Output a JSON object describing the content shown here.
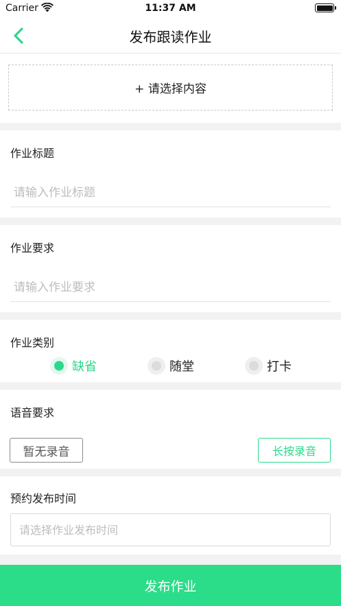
{
  "status_bar": {
    "carrier": "Carrier",
    "time": "11:37 AM"
  },
  "nav": {
    "title": "发布跟读作业",
    "back_icon": "chevron-left-icon"
  },
  "select_content": {
    "label": "+ 请选择内容"
  },
  "title_section": {
    "label": "作业标题",
    "placeholder": "请输入作业标题",
    "value": ""
  },
  "requirement_section": {
    "label": "作业要求",
    "placeholder": "请输入作业要求",
    "value": ""
  },
  "type_section": {
    "label": "作业类别",
    "options": [
      {
        "label": "缺省",
        "selected": true
      },
      {
        "label": "随堂",
        "selected": false
      },
      {
        "label": "打卡",
        "selected": false
      }
    ]
  },
  "voice_section": {
    "label": "语音要求",
    "no_record_label": "暂无录音",
    "hold_record_label": "长按录音"
  },
  "schedule_section": {
    "label": "预约发布时间",
    "placeholder": "请选择作业发布时间",
    "value": ""
  },
  "submit": {
    "label": "发布作业"
  },
  "colors": {
    "accent": "#2bd98a",
    "submit_bg": "#2bdc89",
    "divider": "#f2f2f2",
    "placeholder": "#bdbdbd"
  }
}
